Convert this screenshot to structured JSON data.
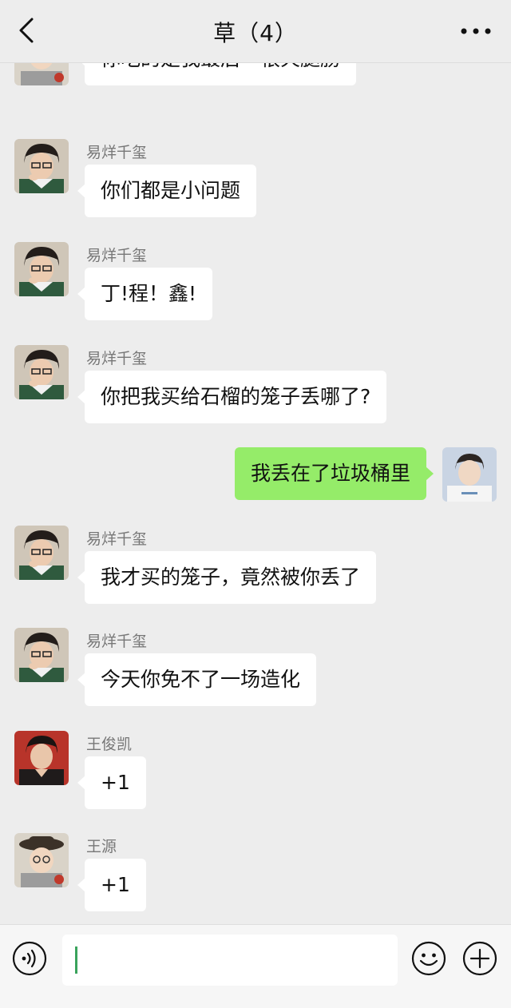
{
  "header": {
    "title": "草（4）",
    "back_icon": "chevron-left-icon",
    "more_icon": "more-dots-icon"
  },
  "messages": [
    {
      "sender": "",
      "text": "你吃的是我最后一根火腿肠",
      "mine": false,
      "avatar": "avatar-wangyuan"
    },
    {
      "sender": "易烊千玺",
      "text": "你们都是小问题",
      "mine": false,
      "avatar": "avatar-yiyangqianxi"
    },
    {
      "sender": "易烊千玺",
      "text": "丁!程！鑫!",
      "mine": false,
      "avatar": "avatar-yiyangqianxi"
    },
    {
      "sender": "易烊千玺",
      "text": "你把我买给石榴的笼子丢哪了?",
      "mine": false,
      "avatar": "avatar-yiyangqianxi"
    },
    {
      "sender": "",
      "text": "我丢在了垃圾桶里",
      "mine": true,
      "avatar": "avatar-self"
    },
    {
      "sender": "易烊千玺",
      "text": "我才买的笼子，竟然被你丢了",
      "mine": false,
      "avatar": "avatar-yiyangqianxi"
    },
    {
      "sender": "易烊千玺",
      "text": "今天你免不了一场造化",
      "mine": false,
      "avatar": "avatar-yiyangqianxi"
    },
    {
      "sender": "王俊凯",
      "text": "+1",
      "mine": false,
      "avatar": "avatar-wangjunkai"
    },
    {
      "sender": "王源",
      "text": "+1",
      "mine": false,
      "avatar": "avatar-wangyuan"
    }
  ],
  "inputbar": {
    "voice_icon": "voice-icon",
    "input_value": "",
    "emoji_icon": "emoji-icon",
    "plus_icon": "plus-icon"
  },
  "colors": {
    "background": "#ededed",
    "bubble_other": "#ffffff",
    "bubble_mine": "#95ec69",
    "sender_name": "#777777",
    "caret": "#3aa35c"
  }
}
